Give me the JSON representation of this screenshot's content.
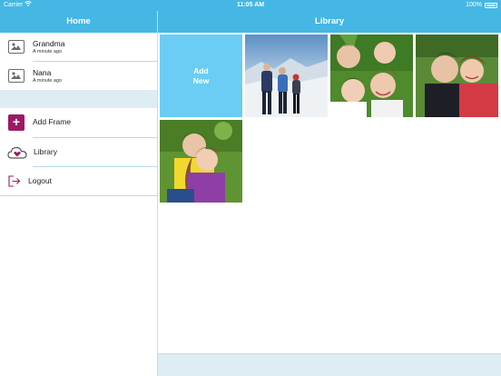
{
  "status_bar": {
    "carrier": "Carrier",
    "time": "11:05 AM",
    "battery": "100%"
  },
  "sidebar": {
    "title": "Home",
    "contacts": [
      {
        "name": "Grandma",
        "time": "A minute ago"
      },
      {
        "name": "Nana",
        "time": "A minute ago"
      }
    ],
    "menu": {
      "add_frame": "Add Frame",
      "library": "Library",
      "logout": "Logout"
    }
  },
  "library": {
    "title": "Library",
    "add_new_line1": "Add",
    "add_new_line2": "New",
    "photos": [
      {
        "name": "photo-snow-family"
      },
      {
        "name": "photo-family-grass"
      },
      {
        "name": "photo-kids-lying"
      },
      {
        "name": "photo-siblings-hug"
      }
    ]
  },
  "colors": {
    "accent": "#45b7e4",
    "add_tile": "#6bcdf3",
    "brand_magenta": "#9c1a63",
    "separator": "#b7dbe9",
    "band": "#deedf4"
  }
}
